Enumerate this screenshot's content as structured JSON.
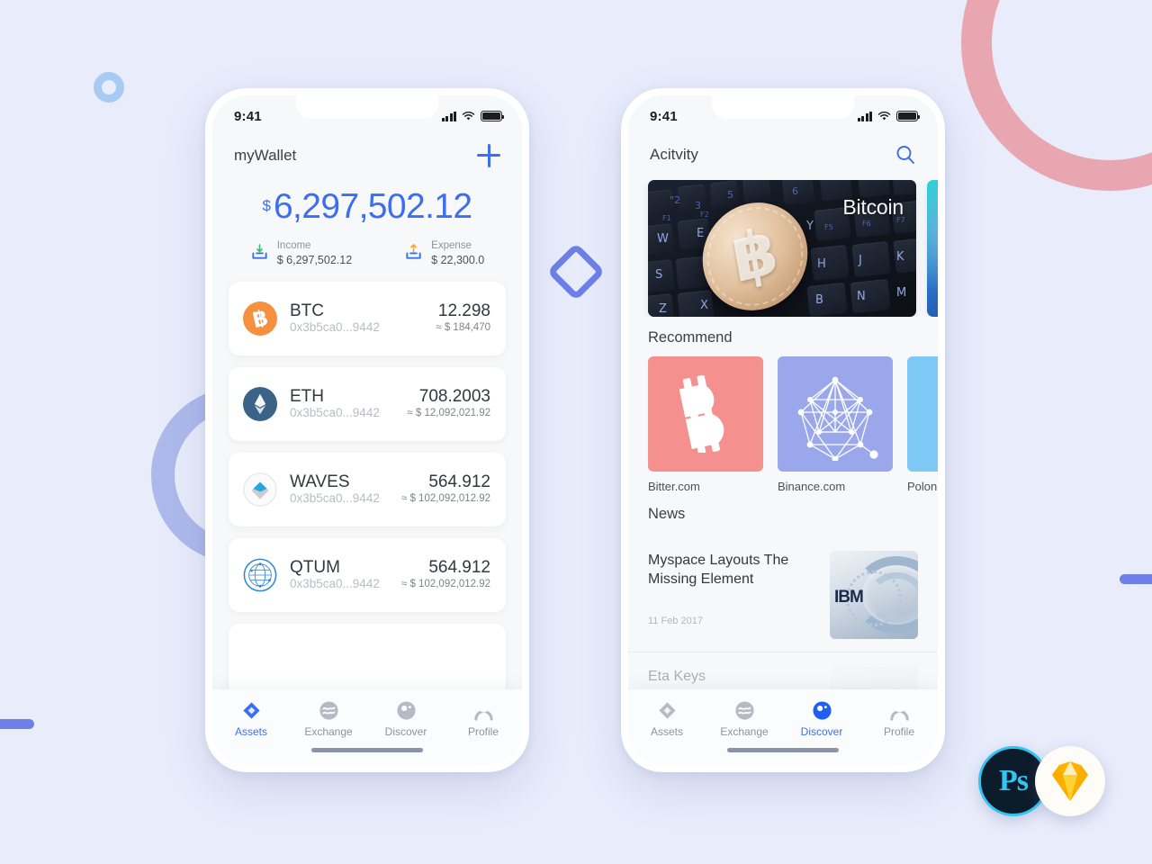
{
  "theme": {
    "background": "#e8ecfb",
    "accent": "#3b6ef0",
    "deco_pink": "#e8a7b0",
    "deco_purple": "#aab6ea",
    "deco_blue": "#6d80e8",
    "deco_lightblue": "#a8cbf3"
  },
  "wallet_screen": {
    "status": {
      "time": "9:41",
      "signal_icon": "cellular-signal-icon",
      "wifi_icon": "wifi-icon",
      "battery_icon": "battery-icon"
    },
    "appbar": {
      "title": "myWallet",
      "add_icon": "plus-icon"
    },
    "balance": {
      "currency": "$",
      "amount": "6,297,502.12"
    },
    "flows": [
      {
        "icon": "income-tray-icon",
        "label": "Income",
        "amount": "$ 6,297,502.12"
      },
      {
        "icon": "expense-tray-icon",
        "label": "Expense",
        "amount": "$ 22,300.0"
      }
    ],
    "coins": [
      {
        "icon": "bitcoin-icon",
        "symbol": "BTC",
        "address": "0x3b5ca0...9442",
        "amount": "12.298",
        "fiat": "≈ $ 184,470"
      },
      {
        "icon": "ethereum-icon",
        "symbol": "ETH",
        "address": "0x3b5ca0...9442",
        "amount": "708.2003",
        "fiat": "≈ $ 12,092,021.92"
      },
      {
        "icon": "waves-icon",
        "symbol": "WAVES",
        "address": "0x3b5ca0...9442",
        "amount": "564.912",
        "fiat": "≈ $ 102,092,012.92"
      },
      {
        "icon": "qtum-icon",
        "symbol": "QTUM",
        "address": "0x3b5ca0...9442",
        "amount": "564.912",
        "fiat": "≈ $ 102,092,012.92"
      }
    ],
    "tabs": [
      {
        "icon": "assets-diamond-icon",
        "label": "Assets",
        "active": true
      },
      {
        "icon": "exchange-wave-icon",
        "label": "Exchange",
        "active": false
      },
      {
        "icon": "discover-compass-icon",
        "label": "Discover",
        "active": false
      },
      {
        "icon": "profile-person-icon",
        "label": "Profile",
        "active": false
      }
    ]
  },
  "discover_screen": {
    "status": {
      "time": "9:41",
      "signal_icon": "cellular-signal-icon",
      "wifi_icon": "wifi-icon",
      "battery_icon": "battery-icon"
    },
    "appbar": {
      "title": "Acitvity",
      "search_icon": "search-icon"
    },
    "banners": [
      {
        "title": "Bitcoin",
        "image": "bitcoin-coin-on-keyboard-photo"
      },
      {
        "title": "",
        "image": "teal-abstract-photo"
      }
    ],
    "recommend": {
      "heading": "Recommend",
      "items": [
        {
          "name": "Bitter.com",
          "icon": "bitcoin-glyph-icon",
          "color": "#f4918e"
        },
        {
          "name": "Binance.com",
          "icon": "network-polygon-icon",
          "color": "#9aa7ea"
        },
        {
          "name": "Polon",
          "icon": "partial-tile-icon",
          "color": "#7ec8f5"
        }
      ]
    },
    "news": {
      "heading": "News",
      "items": [
        {
          "title": "Myspace Layouts The Missing Element",
          "date": "11 Feb 2017",
          "thumb": "ibm-server-photo"
        },
        {
          "title": "Eta Keys",
          "date": "",
          "thumb": "person-avatar-photo"
        }
      ]
    },
    "tabs": [
      {
        "icon": "assets-diamond-icon",
        "label": "Assets",
        "active": false
      },
      {
        "icon": "exchange-wave-icon",
        "label": "Exchange",
        "active": false
      },
      {
        "icon": "discover-compass-icon",
        "label": "Discover",
        "active": true
      },
      {
        "icon": "profile-person-icon",
        "label": "Profile",
        "active": false
      }
    ]
  },
  "badges": [
    {
      "name": "photoshop-badge",
      "label": "Ps"
    },
    {
      "name": "sketch-badge",
      "label": ""
    }
  ]
}
